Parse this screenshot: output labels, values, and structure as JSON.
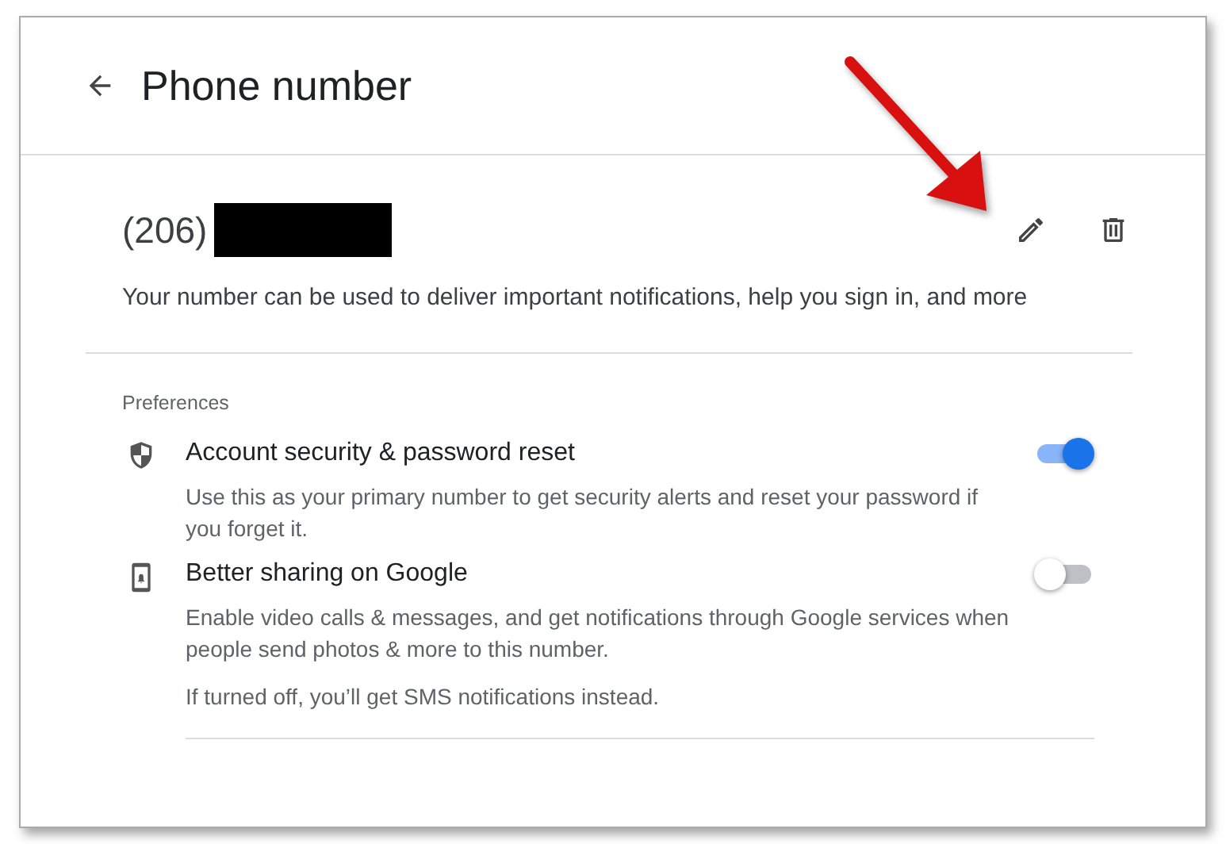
{
  "header": {
    "title": "Phone number"
  },
  "phone": {
    "number": "(206)",
    "redacted": true,
    "description": "Your number can be used to deliver important notifications, help you sign in, and more"
  },
  "preferences": {
    "heading": "Preferences",
    "items": [
      {
        "kind": "shield",
        "title": "Account security & password reset",
        "description": "Use this as your primary number to get security alerts and reset your password if you forget it.",
        "on": true
      },
      {
        "kind": "phone",
        "title": "Better sharing on Google",
        "description": "Enable video calls & messages, and get notifications through Google services when people send photos & more to this number.",
        "note": "If turned off, you’ll get SMS notifications instead.",
        "on": false
      }
    ]
  }
}
